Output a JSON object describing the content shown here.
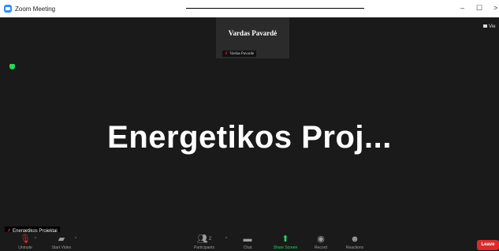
{
  "window": {
    "title": "Zoom Meeting",
    "minimize": "–",
    "maximize": "☐",
    "close": ">"
  },
  "speaker_strip": {
    "name": "Vardas Pavardė",
    "tag": "Vardas Pavarde"
  },
  "view_button": {
    "label": "Vie"
  },
  "main_video": {
    "display_name": "Energetikos Proj..."
  },
  "participant_tag": {
    "label": "Energetikos Projektai"
  },
  "toolbar": {
    "unmute": "Unmute",
    "start_video": "Start Video",
    "participants": "Participants",
    "participant_count": "2",
    "chat": "Chat",
    "share_screen": "Share Screen",
    "record": "Record",
    "reactions": "Reactions",
    "leave": "Leave"
  },
  "colors": {
    "accent_green": "#23d959",
    "muted_red": "#e02828",
    "zoom_blue": "#2d8cff",
    "background": "#1a1a1a"
  }
}
